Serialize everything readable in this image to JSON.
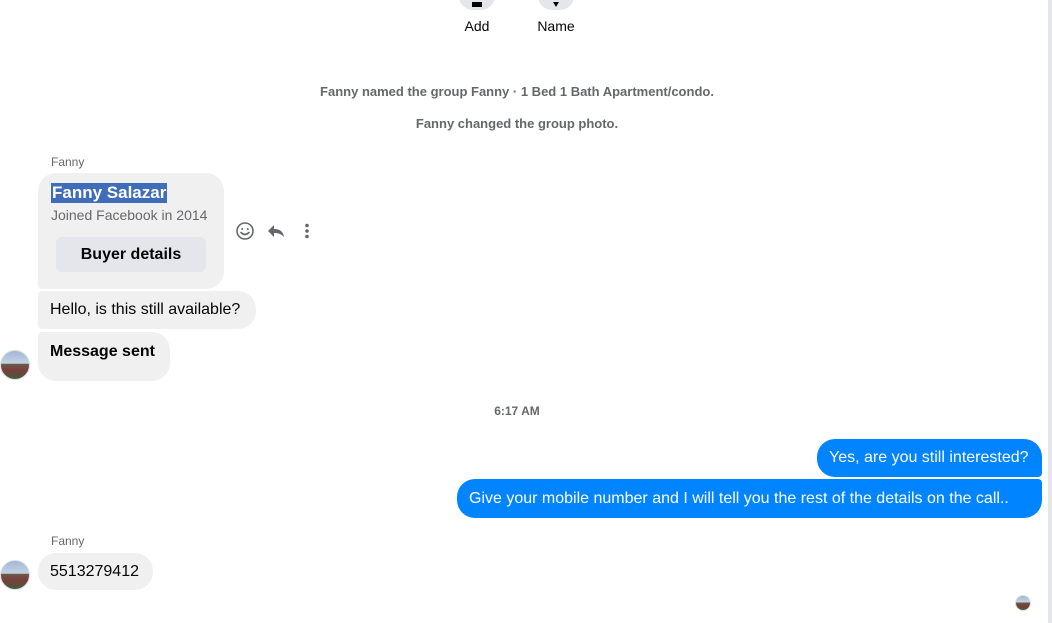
{
  "top_actions": [
    {
      "label": "Add",
      "icon": "add-person-icon"
    },
    {
      "label": "Name",
      "icon": "pencil-icon"
    }
  ],
  "system_messages": [
    "Fanny named the group Fanny · 1 Bed 1 Bath Apartment/condo.",
    "Fanny changed the group photo."
  ],
  "thread": {
    "sender_name_1": "Fanny",
    "card": {
      "name": "Fanny Salazar",
      "joined": "Joined Facebook in 2014",
      "button": "Buyer details"
    },
    "msg_available": "Hello, is this still available?",
    "msg_sent": "Message sent",
    "timestamp": "6:17 AM",
    "mine_1": "Yes, are you still interested?",
    "mine_2": "Give your mobile number and I will tell you the rest of the details on the call..",
    "sender_name_2": "Fanny",
    "msg_number": "5513279412"
  },
  "hover_actions": [
    "emoji-react-icon",
    "reply-icon",
    "more-options-icon"
  ],
  "colors": {
    "mine_bubble": "#0084ff",
    "theirs_bubble": "#f0f0f0",
    "secondary_text": "#65676b",
    "selection": "#3f6db9"
  }
}
